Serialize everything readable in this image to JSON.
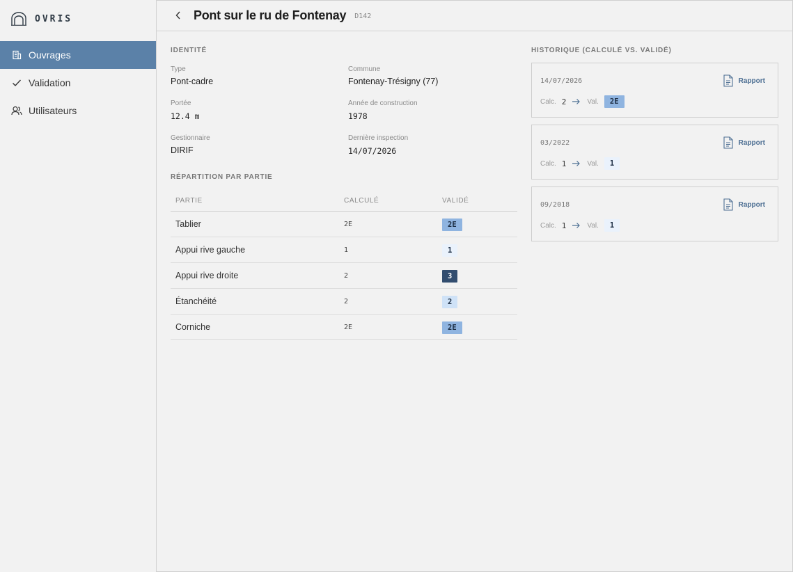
{
  "app": {
    "name": "OVRIS"
  },
  "nav": [
    {
      "label": "Ouvrages",
      "icon": "building-icon",
      "active": true
    },
    {
      "label": "Validation",
      "icon": "check-icon",
      "active": false
    },
    {
      "label": "Utilisateurs",
      "icon": "users-icon",
      "active": false
    }
  ],
  "header": {
    "title": "Pont sur le ru de Fontenay",
    "code": "D142"
  },
  "identity": {
    "section": "IDENTITÉ",
    "type_label": "Type",
    "type_value": "Pont-cadre",
    "commune_label": "Commune",
    "commune_value": "Fontenay-Trésigny (77)",
    "portee_label": "Portée",
    "portee_value": "12.4 m",
    "annee_label": "Année de construction",
    "annee_value": "1978",
    "gest_label": "Gestionnaire",
    "gest_value": "DIRIF",
    "insp_label": "Dernière inspection",
    "insp_value": "14/07/2026"
  },
  "repartition": {
    "section": "RÉPARTITION PAR PARTIE",
    "headers": {
      "partie": "PARTIE",
      "calcule": "CALCULÉ",
      "valide": "VALIDÉ"
    },
    "rows": [
      {
        "partie": "Tablier",
        "calcule": "2E",
        "valide": "2E",
        "color": "#8fb4e0",
        "text": "#1e2f45"
      },
      {
        "partie": "Appui rive gauche",
        "calcule": "1",
        "valide": "1",
        "color": "#eaf2fc",
        "text": "#1e2f45"
      },
      {
        "partie": "Appui rive droite",
        "calcule": "2",
        "valide": "3",
        "color": "#324d6f",
        "text": "#ffffff"
      },
      {
        "partie": "Étanchéité",
        "calcule": "2",
        "valide": "2",
        "color": "#cfe2f7",
        "text": "#1e2f45"
      },
      {
        "partie": "Corniche",
        "calcule": "2E",
        "valide": "2E",
        "color": "#8fb4e0",
        "text": "#1e2f45"
      }
    ]
  },
  "history": {
    "section": "HISTORIQUE (CALCULÉ VS. VALIDÉ)",
    "report_label": "Rapport",
    "calc_label": "Calc.",
    "val_label": "Val.",
    "items": [
      {
        "date": "14/07/2026",
        "calc": "2",
        "val": "2E",
        "color": "#8fb4e0",
        "text": "#1e2f45"
      },
      {
        "date": "03/2022",
        "calc": "1",
        "val": "1",
        "color": "#eaf2fc",
        "text": "#1e2f45"
      },
      {
        "date": "09/2018",
        "calc": "1",
        "val": "1",
        "color": "#eaf2fc",
        "text": "#1e2f45"
      }
    ]
  },
  "colors": {
    "accent": "#5b81a8",
    "link": "#4d6f93"
  }
}
